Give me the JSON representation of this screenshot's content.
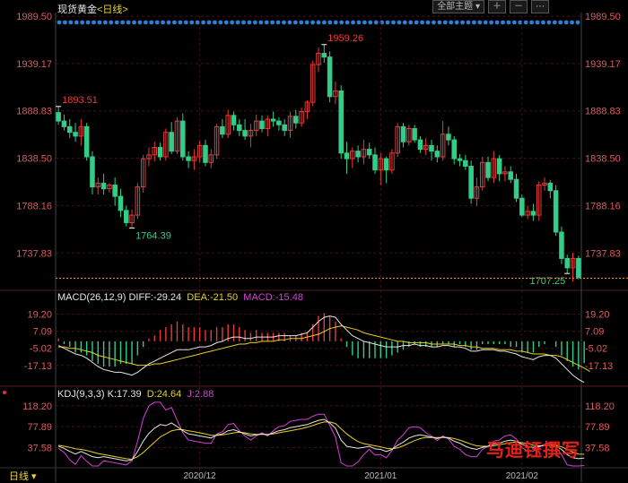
{
  "header": {
    "instrument": "现货黄金",
    "period": "<日线>",
    "theme_button": "全部主题",
    "bottom_period": "日线"
  },
  "colors": {
    "up": "#e83a3a",
    "down": "#33cc88",
    "grid": "#3a1616",
    "axis_price": "#e05a5a",
    "dots": "#2f7fd6",
    "last_price_line": "#ff9a1a",
    "diff": "#e6e6e6",
    "dea": "#e6d21e",
    "macd": "#d640d6",
    "k": "#e6e6e6",
    "d": "#e6d21e",
    "j": "#d640d6"
  },
  "chart_data": {
    "type": "candlestick",
    "price_axis": {
      "ticks": [
        "1989.50",
        "1939.17",
        "1888.83",
        "1838.50",
        "1788.16",
        "1737.83"
      ],
      "ylim": [
        1700,
        1989.5
      ]
    },
    "x_labels": [
      "2020/12",
      "2021/01",
      "2021/02"
    ],
    "annotations": [
      {
        "label": "1893.51",
        "index": 0,
        "type": "high"
      },
      {
        "label": "1764.39",
        "index": 13,
        "type": "low"
      },
      {
        "label": "1959.26",
        "index": 47,
        "type": "high"
      },
      {
        "label": "1707.25",
        "index": 90,
        "type": "low"
      }
    ],
    "candles": [
      {
        "o": 1887,
        "h": 1893.51,
        "l": 1874,
        "c": 1878
      },
      {
        "o": 1878,
        "h": 1885,
        "l": 1868,
        "c": 1872
      },
      {
        "o": 1872,
        "h": 1880,
        "l": 1860,
        "c": 1866
      },
      {
        "o": 1866,
        "h": 1876,
        "l": 1856,
        "c": 1862
      },
      {
        "o": 1862,
        "h": 1880,
        "l": 1852,
        "c": 1872
      },
      {
        "o": 1872,
        "h": 1876,
        "l": 1836,
        "c": 1840
      },
      {
        "o": 1840,
        "h": 1846,
        "l": 1800,
        "c": 1808
      },
      {
        "o": 1808,
        "h": 1818,
        "l": 1800,
        "c": 1812
      },
      {
        "o": 1812,
        "h": 1822,
        "l": 1800,
        "c": 1806
      },
      {
        "o": 1806,
        "h": 1812,
        "l": 1802,
        "c": 1810
      },
      {
        "o": 1810,
        "h": 1818,
        "l": 1788,
        "c": 1798
      },
      {
        "o": 1798,
        "h": 1806,
        "l": 1776,
        "c": 1783
      },
      {
        "o": 1783,
        "h": 1788,
        "l": 1766,
        "c": 1770
      },
      {
        "o": 1770,
        "h": 1784,
        "l": 1764.39,
        "c": 1778
      },
      {
        "o": 1778,
        "h": 1812,
        "l": 1774,
        "c": 1808
      },
      {
        "o": 1808,
        "h": 1842,
        "l": 1802,
        "c": 1838
      },
      {
        "o": 1838,
        "h": 1850,
        "l": 1830,
        "c": 1842
      },
      {
        "o": 1842,
        "h": 1856,
        "l": 1835,
        "c": 1850
      },
      {
        "o": 1850,
        "h": 1855,
        "l": 1836,
        "c": 1840
      },
      {
        "o": 1840,
        "h": 1870,
        "l": 1836,
        "c": 1866
      },
      {
        "o": 1866,
        "h": 1877,
        "l": 1843,
        "c": 1846
      },
      {
        "o": 1846,
        "h": 1882,
        "l": 1843,
        "c": 1878
      },
      {
        "o": 1878,
        "h": 1886,
        "l": 1836,
        "c": 1840
      },
      {
        "o": 1840,
        "h": 1846,
        "l": 1828,
        "c": 1836
      },
      {
        "o": 1836,
        "h": 1848,
        "l": 1826,
        "c": 1840
      },
      {
        "o": 1840,
        "h": 1857,
        "l": 1834,
        "c": 1852
      },
      {
        "o": 1852,
        "h": 1858,
        "l": 1830,
        "c": 1834
      },
      {
        "o": 1834,
        "h": 1848,
        "l": 1828,
        "c": 1842
      },
      {
        "o": 1842,
        "h": 1875,
        "l": 1838,
        "c": 1872
      },
      {
        "o": 1872,
        "h": 1880,
        "l": 1860,
        "c": 1864
      },
      {
        "o": 1864,
        "h": 1890,
        "l": 1860,
        "c": 1884
      },
      {
        "o": 1884,
        "h": 1888,
        "l": 1868,
        "c": 1874
      },
      {
        "o": 1874,
        "h": 1880,
        "l": 1862,
        "c": 1868
      },
      {
        "o": 1868,
        "h": 1880,
        "l": 1858,
        "c": 1862
      },
      {
        "o": 1862,
        "h": 1875,
        "l": 1850,
        "c": 1868
      },
      {
        "o": 1868,
        "h": 1885,
        "l": 1862,
        "c": 1878
      },
      {
        "o": 1878,
        "h": 1884,
        "l": 1866,
        "c": 1870
      },
      {
        "o": 1870,
        "h": 1884,
        "l": 1862,
        "c": 1880
      },
      {
        "o": 1880,
        "h": 1888,
        "l": 1872,
        "c": 1878
      },
      {
        "o": 1878,
        "h": 1882,
        "l": 1868,
        "c": 1874
      },
      {
        "o": 1874,
        "h": 1880,
        "l": 1862,
        "c": 1868
      },
      {
        "o": 1868,
        "h": 1888,
        "l": 1860,
        "c": 1883
      },
      {
        "o": 1883,
        "h": 1890,
        "l": 1870,
        "c": 1876
      },
      {
        "o": 1876,
        "h": 1892,
        "l": 1872,
        "c": 1888
      },
      {
        "o": 1888,
        "h": 1900,
        "l": 1880,
        "c": 1898
      },
      {
        "o": 1898,
        "h": 1942,
        "l": 1894,
        "c": 1938
      },
      {
        "o": 1938,
        "h": 1956,
        "l": 1930,
        "c": 1950
      },
      {
        "o": 1950,
        "h": 1959.26,
        "l": 1940,
        "c": 1946
      },
      {
        "o": 1946,
        "h": 1952,
        "l": 1898,
        "c": 1904
      },
      {
        "o": 1904,
        "h": 1920,
        "l": 1896,
        "c": 1910
      },
      {
        "o": 1910,
        "h": 1916,
        "l": 1838,
        "c": 1844
      },
      {
        "o": 1844,
        "h": 1856,
        "l": 1822,
        "c": 1838
      },
      {
        "o": 1838,
        "h": 1850,
        "l": 1828,
        "c": 1846
      },
      {
        "o": 1846,
        "h": 1852,
        "l": 1834,
        "c": 1840
      },
      {
        "o": 1840,
        "h": 1858,
        "l": 1832,
        "c": 1848
      },
      {
        "o": 1848,
        "h": 1855,
        "l": 1838,
        "c": 1842
      },
      {
        "o": 1842,
        "h": 1850,
        "l": 1822,
        "c": 1826
      },
      {
        "o": 1826,
        "h": 1844,
        "l": 1810,
        "c": 1838
      },
      {
        "o": 1838,
        "h": 1840,
        "l": 1812,
        "c": 1826
      },
      {
        "o": 1826,
        "h": 1848,
        "l": 1822,
        "c": 1844
      },
      {
        "o": 1844,
        "h": 1876,
        "l": 1840,
        "c": 1872
      },
      {
        "o": 1872,
        "h": 1876,
        "l": 1850,
        "c": 1856
      },
      {
        "o": 1856,
        "h": 1874,
        "l": 1852,
        "c": 1870
      },
      {
        "o": 1870,
        "h": 1874,
        "l": 1855,
        "c": 1858
      },
      {
        "o": 1858,
        "h": 1862,
        "l": 1844,
        "c": 1848
      },
      {
        "o": 1848,
        "h": 1860,
        "l": 1842,
        "c": 1852
      },
      {
        "o": 1852,
        "h": 1858,
        "l": 1836,
        "c": 1846
      },
      {
        "o": 1846,
        "h": 1852,
        "l": 1834,
        "c": 1840
      },
      {
        "o": 1840,
        "h": 1878,
        "l": 1836,
        "c": 1864
      },
      {
        "o": 1864,
        "h": 1872,
        "l": 1852,
        "c": 1858
      },
      {
        "o": 1858,
        "h": 1862,
        "l": 1832,
        "c": 1838
      },
      {
        "o": 1838,
        "h": 1843,
        "l": 1830,
        "c": 1836
      },
      {
        "o": 1836,
        "h": 1842,
        "l": 1826,
        "c": 1830
      },
      {
        "o": 1830,
        "h": 1836,
        "l": 1790,
        "c": 1796
      },
      {
        "o": 1796,
        "h": 1818,
        "l": 1788,
        "c": 1808
      },
      {
        "o": 1808,
        "h": 1840,
        "l": 1804,
        "c": 1834
      },
      {
        "o": 1834,
        "h": 1840,
        "l": 1814,
        "c": 1818
      },
      {
        "o": 1818,
        "h": 1846,
        "l": 1812,
        "c": 1838
      },
      {
        "o": 1838,
        "h": 1842,
        "l": 1814,
        "c": 1822
      },
      {
        "o": 1822,
        "h": 1830,
        "l": 1814,
        "c": 1824
      },
      {
        "o": 1824,
        "h": 1830,
        "l": 1812,
        "c": 1816
      },
      {
        "o": 1816,
        "h": 1822,
        "l": 1792,
        "c": 1796
      },
      {
        "o": 1796,
        "h": 1800,
        "l": 1776,
        "c": 1778
      },
      {
        "o": 1778,
        "h": 1788,
        "l": 1774,
        "c": 1782
      },
      {
        "o": 1782,
        "h": 1790,
        "l": 1772,
        "c": 1778
      },
      {
        "o": 1778,
        "h": 1814,
        "l": 1772,
        "c": 1810
      },
      {
        "o": 1810,
        "h": 1818,
        "l": 1804,
        "c": 1812
      },
      {
        "o": 1812,
        "h": 1815,
        "l": 1796,
        "c": 1804
      },
      {
        "o": 1804,
        "h": 1810,
        "l": 1756,
        "c": 1760
      },
      {
        "o": 1760,
        "h": 1766,
        "l": 1726,
        "c": 1732
      },
      {
        "o": 1732,
        "h": 1736,
        "l": 1716,
        "c": 1722
      },
      {
        "o": 1722,
        "h": 1738,
        "l": 1707.25,
        "c": 1732
      },
      {
        "o": 1732,
        "h": 1735,
        "l": 1710,
        "c": 1712
      }
    ],
    "macd": {
      "title": "MACD(26,12,9)",
      "diff_label": "DIFF:-29.24",
      "dea_label": "DEA:-21.50",
      "macd_label": "MACD:-15.48",
      "ticks": [
        "19.20",
        "7.09",
        "-5.02",
        "-17.13"
      ],
      "ylim": [
        -30,
        26
      ],
      "diff": [
        -3,
        -5,
        -7,
        -9,
        -10,
        -12,
        -15,
        -18,
        -20,
        -21,
        -22,
        -22,
        -23,
        -24,
        -22,
        -19,
        -16,
        -14,
        -12,
        -10,
        -8,
        -6,
        -6,
        -6,
        -5,
        -4,
        -4,
        -3,
        -1,
        0,
        2,
        3,
        3,
        2,
        2,
        3,
        3,
        3,
        3,
        4,
        4,
        4,
        4,
        5,
        6,
        10,
        14,
        17,
        18,
        17,
        12,
        8,
        4,
        2,
        0,
        -1,
        -2,
        -3,
        -4,
        -4,
        -4,
        -3,
        -3,
        -2,
        -3,
        -3,
        -4,
        -4,
        -3,
        -3,
        -4,
        -4,
        -5,
        -7,
        -7,
        -6,
        -6,
        -6,
        -7,
        -7,
        -8,
        -9,
        -11,
        -12,
        -13,
        -11,
        -10,
        -10,
        -12,
        -16,
        -20,
        -24,
        -27,
        -29.24
      ],
      "dea": [
        -4,
        -4,
        -5,
        -5,
        -6,
        -7,
        -8,
        -10,
        -11,
        -12,
        -13,
        -14,
        -15,
        -16,
        -17,
        -17,
        -17,
        -16,
        -16,
        -15,
        -14,
        -13,
        -12,
        -11,
        -10,
        -9,
        -8,
        -7,
        -6,
        -5,
        -4,
        -3,
        -2,
        -2,
        -1,
        -1,
        0,
        0,
        0,
        1,
        1,
        2,
        2,
        2,
        3,
        4,
        5,
        7,
        9,
        10,
        11,
        10,
        9,
        8,
        6,
        5,
        4,
        3,
        2,
        1,
        0,
        0,
        -1,
        -1,
        -1,
        -1,
        -2,
        -2,
        -2,
        -2,
        -2,
        -3,
        -3,
        -4,
        -4,
        -5,
        -5,
        -5,
        -6,
        -6,
        -6,
        -7,
        -7,
        -8,
        -9,
        -9,
        -9,
        -10,
        -10,
        -11,
        -13,
        -15,
        -17,
        -19,
        -21.5
      ],
      "macd": [
        2,
        -2,
        -4,
        -8,
        -8,
        -10,
        -14,
        -16,
        -18,
        -18,
        -18,
        -16,
        -16,
        -16,
        -10,
        -4,
        2,
        4,
        8,
        10,
        12,
        14,
        12,
        10,
        10,
        10,
        8,
        8,
        10,
        10,
        12,
        12,
        10,
        8,
        6,
        8,
        6,
        6,
        6,
        6,
        6,
        4,
        4,
        6,
        6,
        12,
        18,
        20,
        18,
        14,
        2,
        -4,
        -10,
        -12,
        -12,
        -12,
        -12,
        -12,
        -12,
        -10,
        -8,
        -6,
        -4,
        -2,
        -4,
        -4,
        -4,
        -4,
        -2,
        -2,
        -4,
        -2,
        -4,
        -6,
        -6,
        -2,
        -2,
        -2,
        -2,
        -2,
        -4,
        -4,
        -8,
        -8,
        -8,
        -4,
        -2,
        0,
        -4,
        -10,
        -14,
        -18,
        -20,
        -15.48
      ]
    },
    "kdj": {
      "title": "KDJ(9,3,3)",
      "k_label": "K:17.39",
      "d_label": "D:24.64",
      "j_label": "J:2.88",
      "ticks": [
        "118.20",
        "77.89",
        "37.58"
      ],
      "ylim": [
        2,
        130
      ],
      "k": [
        40,
        36,
        30,
        25,
        30,
        25,
        20,
        18,
        20,
        18,
        16,
        14,
        12,
        14,
        30,
        50,
        65,
        75,
        82,
        80,
        85,
        78,
        70,
        64,
        62,
        60,
        58,
        56,
        62,
        64,
        70,
        72,
        68,
        64,
        60,
        62,
        64,
        62,
        66,
        70,
        72,
        76,
        78,
        80,
        82,
        86,
        90,
        92,
        85,
        75,
        52,
        40,
        38,
        36,
        38,
        40,
        35,
        34,
        30,
        34,
        42,
        48,
        56,
        60,
        62,
        60,
        58,
        55,
        58,
        56,
        50,
        46,
        40,
        36,
        34,
        38,
        40,
        44,
        46,
        50,
        52,
        50,
        44,
        40,
        38,
        40,
        42,
        44,
        40,
        34,
        24,
        18,
        16,
        17.39
      ],
      "d": [
        42,
        40,
        38,
        35,
        34,
        32,
        29,
        26,
        24,
        22,
        20,
        18,
        16,
        15,
        20,
        28,
        38,
        48,
        58,
        64,
        70,
        72,
        72,
        70,
        68,
        66,
        64,
        61,
        61,
        62,
        64,
        66,
        67,
        66,
        64,
        63,
        63,
        63,
        64,
        66,
        68,
        70,
        72,
        74,
        77,
        80,
        84,
        87,
        87,
        84,
        74,
        64,
        56,
        49,
        45,
        43,
        41,
        39,
        36,
        35,
        37,
        41,
        46,
        51,
        55,
        57,
        57,
        57,
        57,
        57,
        55,
        52,
        48,
        44,
        41,
        40,
        40,
        41,
        43,
        45,
        47,
        48,
        47,
        45,
        42,
        41,
        41,
        42,
        41,
        39,
        34,
        29,
        25,
        24.64
      ],
      "j": [
        36,
        28,
        14,
        5,
        22,
        11,
        2,
        2,
        12,
        10,
        8,
        6,
        4,
        12,
        50,
        94,
        118,
        125,
        125,
        110,
        115,
        90,
        66,
        52,
        50,
        48,
        46,
        46,
        64,
        68,
        82,
        84,
        70,
        60,
        52,
        60,
        66,
        60,
        70,
        78,
        80,
        88,
        90,
        92,
        92,
        98,
        102,
        102,
        80,
        58,
        8,
        2,
        2,
        10,
        24,
        34,
        23,
        24,
        18,
        32,
        52,
        62,
        76,
        78,
        76,
        66,
        60,
        51,
        60,
        54,
        40,
        34,
        24,
        20,
        20,
        34,
        40,
        50,
        52,
        60,
        62,
        54,
        38,
        30,
        30,
        38,
        44,
        48,
        38,
        24,
        4,
        2,
        2,
        2.88
      ]
    }
  }
}
